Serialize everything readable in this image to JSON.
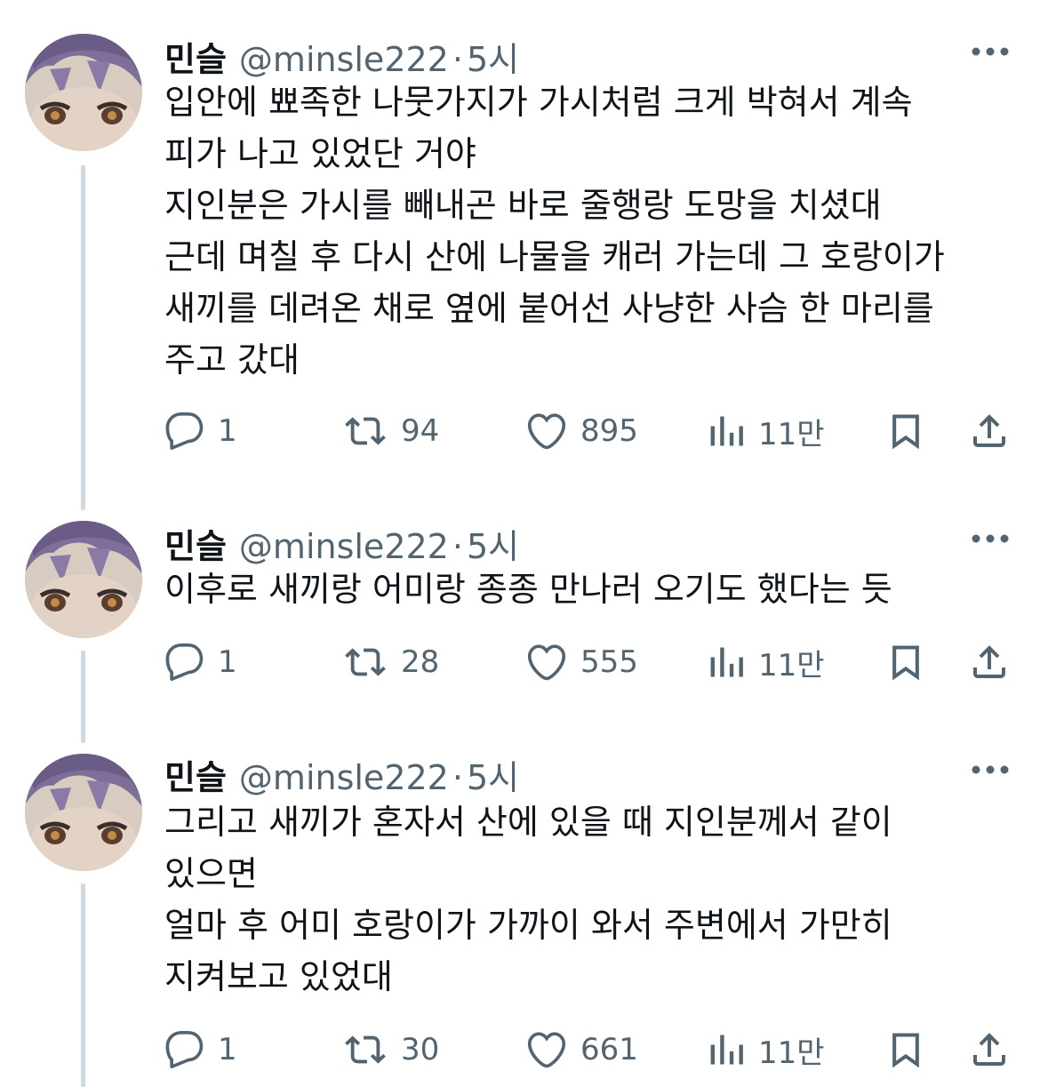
{
  "colors": {
    "text": "#0f1419",
    "secondary": "#536471",
    "thread_line": "#cfd9de",
    "background": "#ffffff"
  },
  "tweets": [
    {
      "display_name": "민슬",
      "handle": "@minsle222",
      "separator": "·",
      "time": "5시",
      "lines": [
        "입안에 뾰족한 나뭇가지가 가시처럼 크게 박혀서 계속",
        "피가 나고 있었단 거야",
        "지인분은 가시를 빼내곤 바로 줄행랑 도망을 치셨대",
        "근데 며칠 후 다시 산에 나물을 캐러 가는데 그 호랑이가",
        "새끼를 데려온 채로 옆에 붙어선 사냥한 사슴 한 마리를",
        "주고 갔대"
      ],
      "replies": "1",
      "retweets": "94",
      "likes": "895",
      "views": "11만"
    },
    {
      "display_name": "민슬",
      "handle": "@minsle222",
      "separator": "·",
      "time": "5시",
      "lines": [
        "이후로 새끼랑 어미랑 종종 만나러 오기도 했다는 듯"
      ],
      "replies": "1",
      "retweets": "28",
      "likes": "555",
      "views": "11만"
    },
    {
      "display_name": "민슬",
      "handle": "@minsle222",
      "separator": "·",
      "time": "5시",
      "lines": [
        "그리고 새끼가 혼자서 산에 있을 때 지인분께서 같이",
        "있으면",
        "얼마 후 어미 호랑이가 가까이 와서 주변에서 가만히",
        "지켜보고 있었대"
      ],
      "replies": "1",
      "retweets": "30",
      "likes": "661",
      "views": "11만"
    }
  ]
}
